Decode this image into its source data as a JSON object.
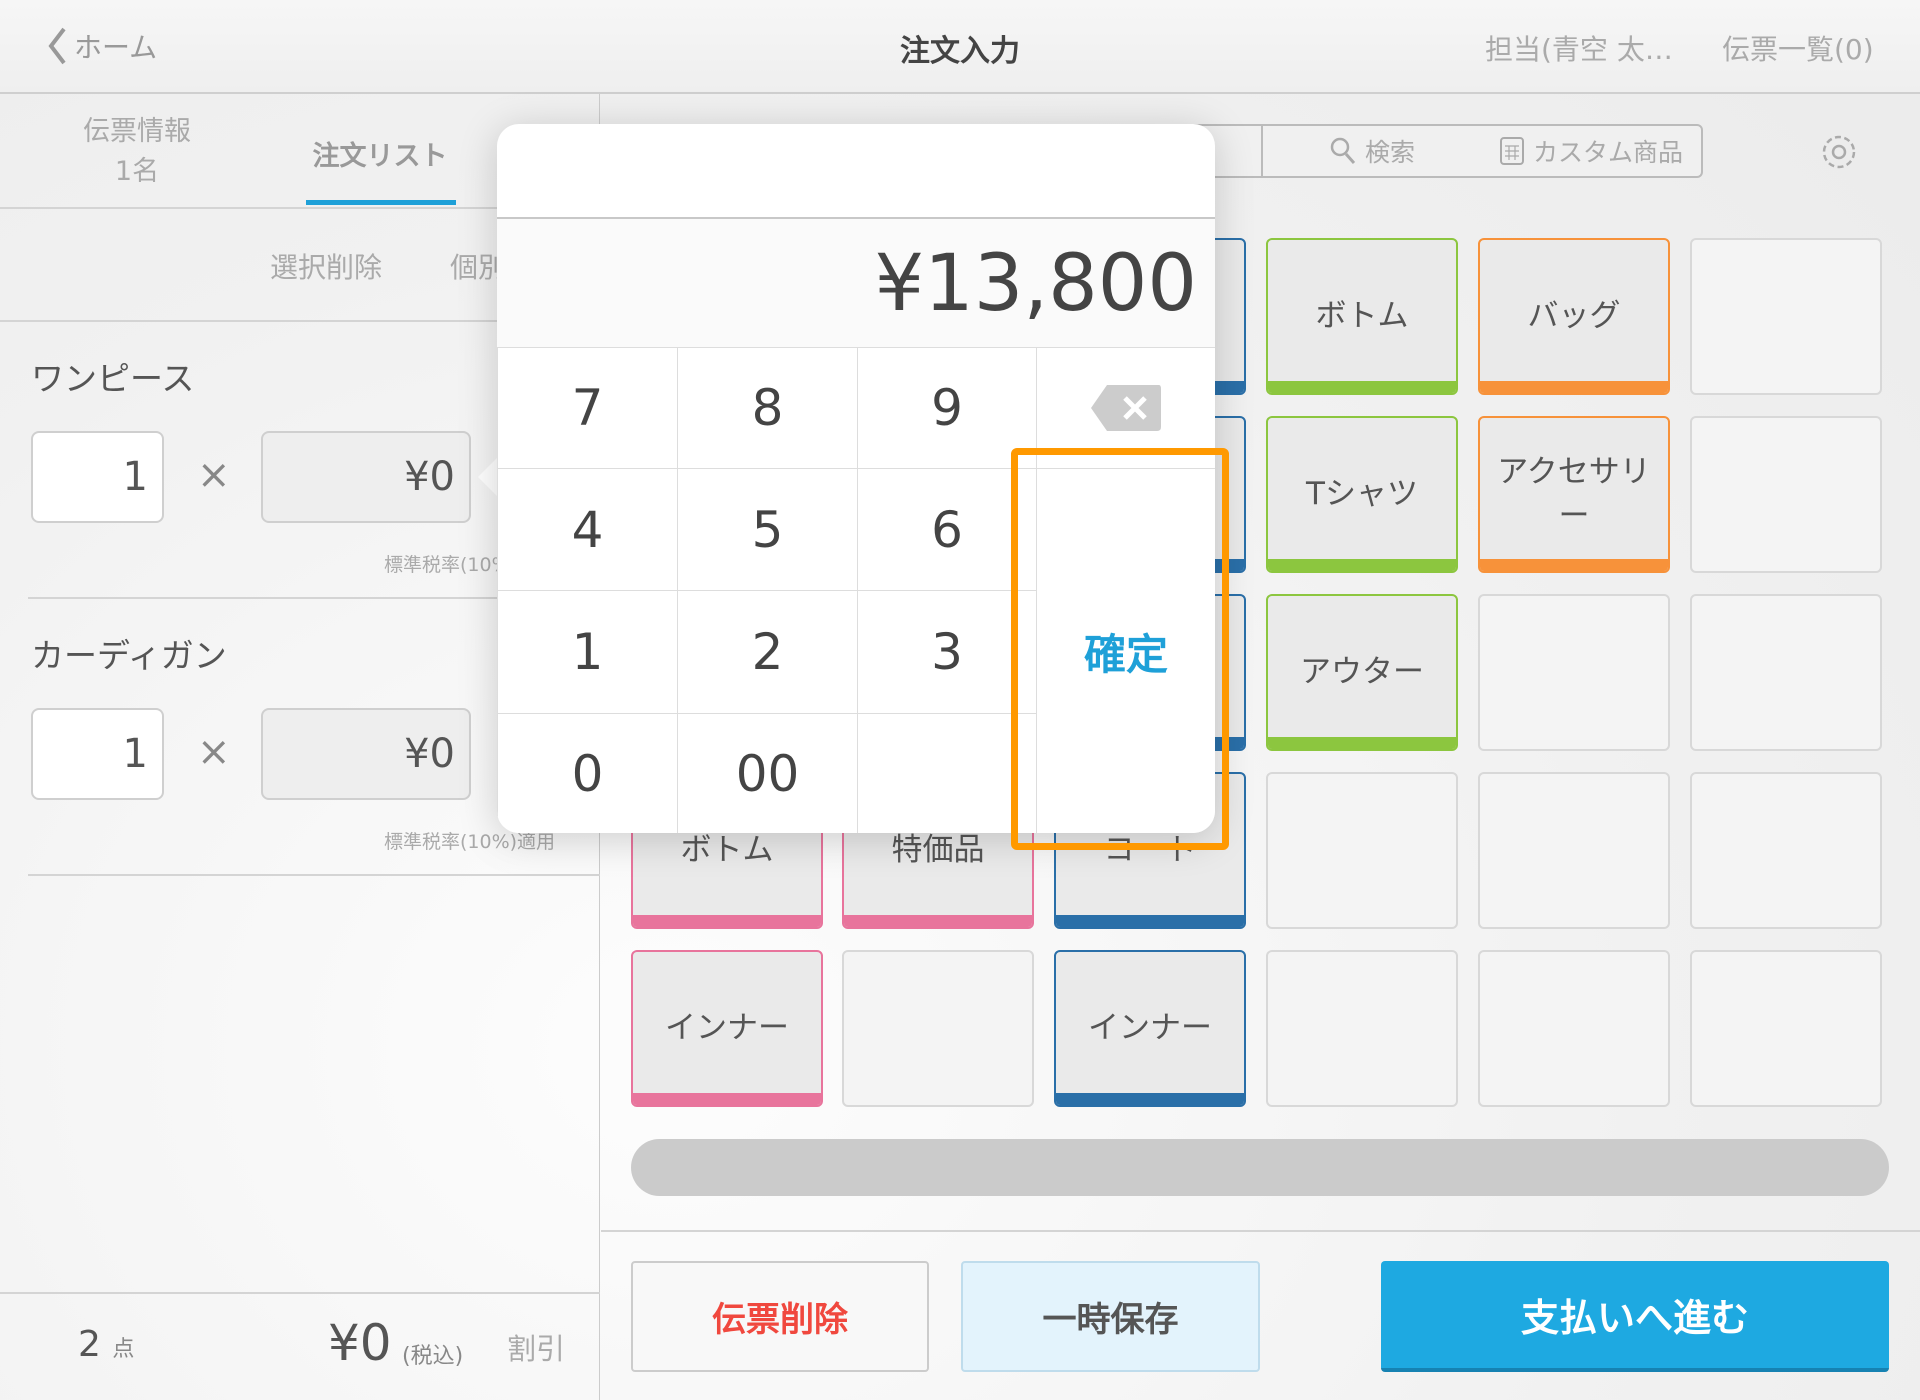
{
  "header": {
    "back_label": "ホーム",
    "title": "注文入力",
    "staff": "担当(青空 太…",
    "slip_list": "伝票一覧(0)"
  },
  "left_tabs": {
    "info_label": "伝票情報",
    "info_count": "1名",
    "order_list": "注文リスト"
  },
  "actions": {
    "delete_selected": "選択削除",
    "individual": "個別"
  },
  "items": [
    {
      "name": "ワンピース",
      "qty": "1",
      "times": "×",
      "price": "¥0",
      "tax": "標準税率(10%)適用"
    },
    {
      "name": "カーディガン",
      "qty": "1",
      "times": "×",
      "price": "¥0",
      "tax": "標準税率(10%)適用"
    }
  ],
  "footer": {
    "count": "2",
    "count_unit": "点",
    "total": "¥0",
    "tax_incl": "(税込)",
    "discount": "割引"
  },
  "toolbar": {
    "search": "検索",
    "custom": "カスタム商品"
  },
  "colors": {
    "green": "#8cc63f",
    "orange": "#f7923a",
    "pink": "#e8749c",
    "blue": "#2a6fa8",
    "primary": "#1ea9e1",
    "highlight": "#ff9900"
  },
  "grid": [
    [
      {
        "label": "",
        "color": ""
      },
      {
        "label": "",
        "color": ""
      },
      {
        "label": "",
        "color": "blue"
      },
      {
        "label": "ボトム",
        "color": "green"
      },
      {
        "label": "バッグ",
        "color": "orange"
      },
      {
        "label": "",
        "color": ""
      }
    ],
    [
      {
        "label": "",
        "color": ""
      },
      {
        "label": "",
        "color": ""
      },
      {
        "label": "",
        "color": "blue"
      },
      {
        "label": "Tシャツ",
        "color": "green"
      },
      {
        "label": "アクセサリー",
        "color": "orange"
      },
      {
        "label": "",
        "color": ""
      }
    ],
    [
      {
        "label": "",
        "color": ""
      },
      {
        "label": "",
        "color": ""
      },
      {
        "label": "",
        "color": "blue"
      },
      {
        "label": "アウター",
        "color": "green"
      },
      {
        "label": "",
        "color": ""
      },
      {
        "label": "",
        "color": ""
      }
    ],
    [
      {
        "label": "ボトム",
        "color": "pink"
      },
      {
        "label": "特価品",
        "color": "pink"
      },
      {
        "label": "コート",
        "color": "blue"
      },
      {
        "label": "",
        "color": ""
      },
      {
        "label": "",
        "color": ""
      },
      {
        "label": "",
        "color": ""
      }
    ],
    [
      {
        "label": "インナー",
        "color": "pink"
      },
      {
        "label": "",
        "color": ""
      },
      {
        "label": "インナー",
        "color": "blue"
      },
      {
        "label": "",
        "color": ""
      },
      {
        "label": "",
        "color": ""
      },
      {
        "label": "",
        "color": ""
      }
    ]
  ],
  "bottom_buttons": {
    "delete_slip": "伝票削除",
    "save_temp": "一時保存",
    "proceed": "支払いへ進む"
  },
  "keypad": {
    "amount": "¥13,800",
    "keys": [
      "7",
      "8",
      "9",
      "4",
      "5",
      "6",
      "1",
      "2",
      "3",
      "0",
      "00"
    ],
    "confirm": "確定"
  }
}
